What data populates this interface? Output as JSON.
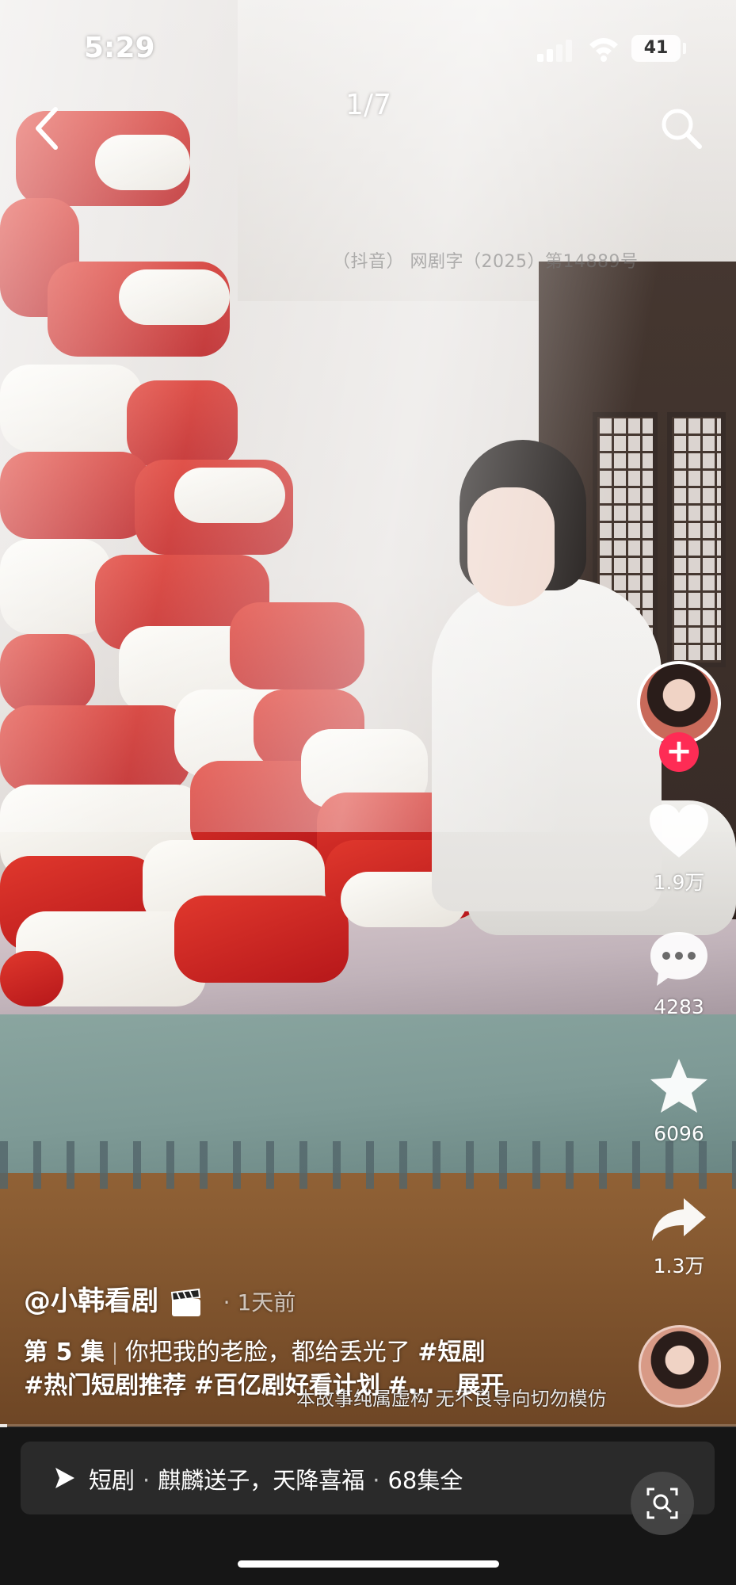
{
  "status_bar": {
    "time": "5:29",
    "battery": "41"
  },
  "nav": {
    "page_counter": "1/7"
  },
  "video": {
    "watermark_text": "（抖音）       网剧字（2025）第14889号",
    "disclaimer": "本故事纯属虚构 无不良导向切勿模仿",
    "progress_percent": 1
  },
  "actions": {
    "likes": "1.9万",
    "comments": "4283",
    "favorites": "6096",
    "shares": "1.3万"
  },
  "caption": {
    "author": "@小韩看剧",
    "posted": "1天前",
    "episode": "第 5 集",
    "text": "你把我的老脸，都给丢光了",
    "tags": [
      "#短剧",
      "#热门短剧推荐",
      "#百亿剧好看计划",
      "#..."
    ],
    "expand_label": "展开"
  },
  "series": {
    "label": "短剧",
    "title": "麒麟送子，天降喜福",
    "episodes": "68集全"
  },
  "icons": {
    "back": "chevron-left-icon",
    "search": "search-icon",
    "like": "heart-icon",
    "comment": "comment-icon",
    "favorite": "star-icon",
    "share": "share-arrow-icon",
    "follow": "plus-icon",
    "clapper": "clapperboard-icon",
    "series": "play-logo-icon",
    "lens": "lens-search-icon"
  },
  "colors": {
    "follow": "#fe2c55",
    "bottom_bar": "#161616",
    "series_bar": "#2a2a2a"
  }
}
